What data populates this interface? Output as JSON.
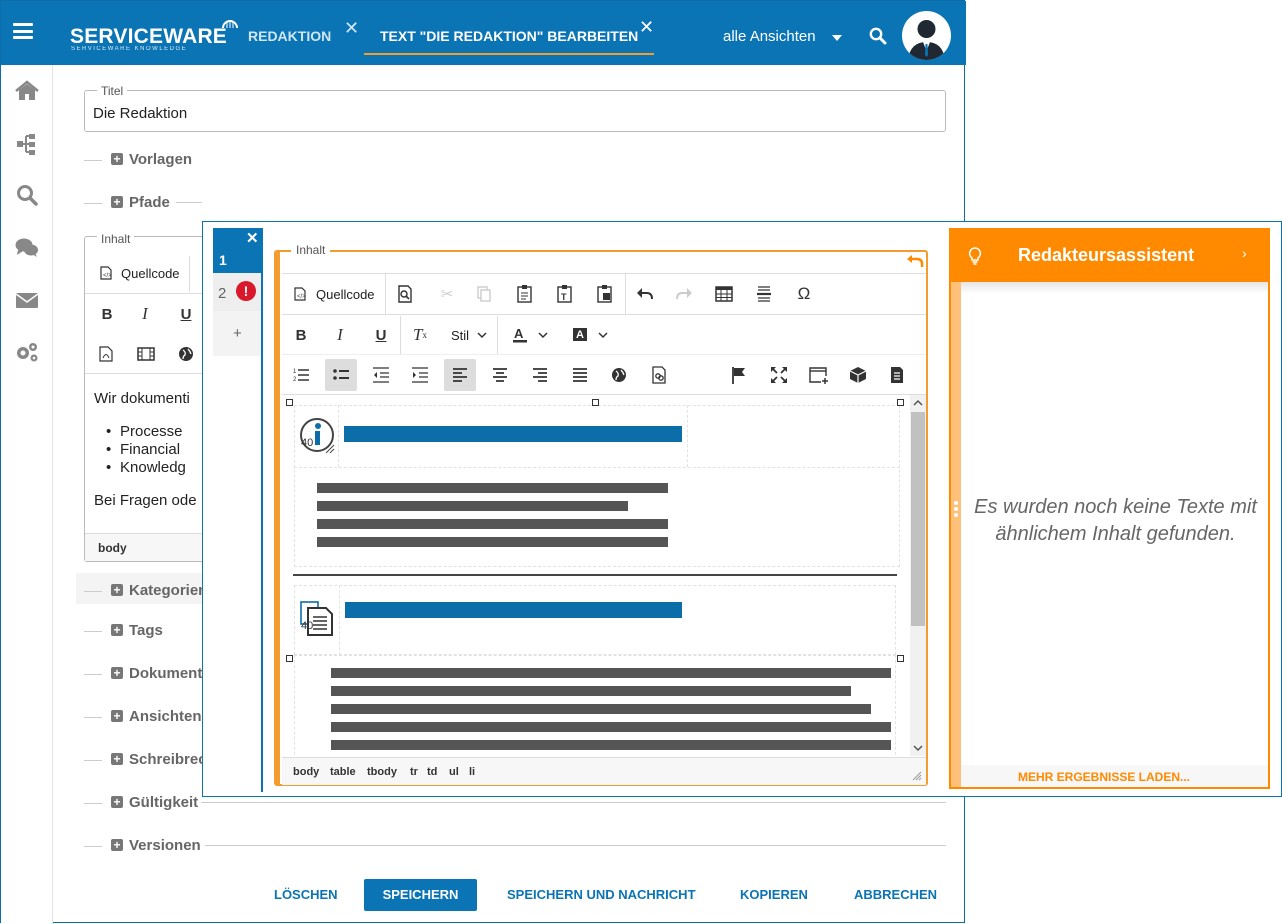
{
  "header": {
    "logo": "SERVICEWARE",
    "logo_sub": "SERVICEWARE KNOWLEDGE",
    "tabs": [
      {
        "label": "REDAKTION"
      },
      {
        "label": "TEXT \"DIE REDAKTION\" BEARBEITEN"
      }
    ],
    "views_label": "alle Ansichten"
  },
  "sidebar": {
    "items": [
      "home-icon",
      "sitemap-icon",
      "search-icon",
      "chat-icon",
      "mail-icon",
      "settings-icon"
    ]
  },
  "form": {
    "title_label": "Titel",
    "title_value": "Die Redaktion",
    "sections_top": [
      "Vorlagen",
      "Pfade"
    ],
    "inhalt_label": "Inhalt",
    "source_label": "Quellcode",
    "content": {
      "intro": "Wir dokumenti",
      "bullets": [
        "Processe",
        "Financial",
        "Knowledg"
      ],
      "outro": "Bei Fragen ode"
    },
    "path_label": "body",
    "sections_bottom": [
      "Kategorien",
      "Tags",
      "Dokumente",
      "Ansichten",
      "Schreibrec",
      "Gültigkeit",
      "Versionen"
    ]
  },
  "actions": {
    "delete": "LÖSCHEN",
    "save": "SPEICHERN",
    "save_notify": "SPEICHERN UND NACHRICHT",
    "copy": "KOPIEREN",
    "cancel": "ABBRECHEN"
  },
  "editor": {
    "tabs": [
      {
        "label": "1"
      },
      {
        "label": "2"
      },
      {
        "label": "+"
      }
    ],
    "label": "Inhalt",
    "source_label": "Quellcode",
    "style_label": "Stil",
    "icon_number": "40",
    "path": [
      "body",
      "table",
      "tbody",
      "tr",
      "td",
      "ul",
      "li"
    ]
  },
  "assistant": {
    "title": "Redakteursassistent",
    "message": "Es wurden noch keine Texte mit ähnlichem Inhalt gefunden.",
    "more": "MEHR ERGEBNISSE LADEN..."
  },
  "colors": {
    "brand": "#0b74b4",
    "accent": "#f39c2f",
    "assistant": "#ff8a00",
    "error": "#d9192b"
  }
}
